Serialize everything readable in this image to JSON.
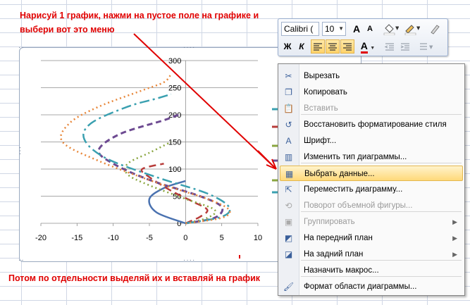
{
  "instructions": {
    "top": "Нарисуй 1 график, нажми на пустое поле на графике и выбери вот это меню",
    "bottom": "Потом по отдельности выделяй их и вставляй на график"
  },
  "toolbar": {
    "font_name": "Calibri (",
    "font_size": "10",
    "grow_font": "A",
    "shrink_font": "A",
    "bold": "Ж",
    "italic": "К",
    "font_color_letter": "A"
  },
  "context_menu": {
    "items": [
      {
        "label": "Вырезать",
        "icon": "scissors-icon",
        "disabled": false
      },
      {
        "label": "Копировать",
        "icon": "copy-icon",
        "disabled": false
      },
      {
        "label": "Вставить",
        "icon": "paste-icon",
        "disabled": true
      },
      {
        "label": "Восстановить форматирование стиля",
        "icon": "reset-style-icon",
        "disabled": false
      },
      {
        "label": "Шрифт...",
        "icon": "font-icon",
        "disabled": false
      },
      {
        "label": "Изменить тип диаграммы...",
        "icon": "chart-type-icon",
        "disabled": false
      },
      {
        "label": "Выбрать данные...",
        "icon": "select-data-icon",
        "disabled": false,
        "highlighted": true
      },
      {
        "label": "Переместить диаграмму...",
        "icon": "move-chart-icon",
        "disabled": false
      },
      {
        "label": "Поворот объемной фигуры...",
        "icon": "rotate-3d-icon",
        "disabled": true
      },
      {
        "label": "Группировать",
        "icon": "group-icon",
        "disabled": true,
        "submenu": true
      },
      {
        "label": "На передний план",
        "icon": "bring-forward-icon",
        "disabled": false,
        "submenu": true
      },
      {
        "label": "На задний план",
        "icon": "send-backward-icon",
        "disabled": false,
        "submenu": true
      },
      {
        "label": "Назначить макрос...",
        "icon": "",
        "disabled": false
      },
      {
        "label": "Формат области диаграммы...",
        "icon": "format-chart-area-icon",
        "disabled": false
      }
    ]
  },
  "colors": {
    "annotation_red": "#e00000",
    "series_blue": "#4a72b0",
    "series_red": "#b83c3a",
    "series_green": "#8aa640",
    "series_purple": "#6d4a91",
    "series_teal": "#3aa0b0",
    "series_orange": "#e8873a"
  },
  "chart_data": {
    "type": "scatter",
    "xticks": [
      "-20",
      "-15",
      "-10",
      "-5",
      "0",
      "5",
      "10"
    ],
    "yticks": [
      "0",
      "50",
      "100",
      "150",
      "200",
      "250",
      "300"
    ],
    "xlim": [
      -20,
      10
    ],
    "ylim": [
      0,
      300
    ],
    "grid": "horizontal",
    "series": [
      {
        "color": "#4a72b0",
        "dash": "solid",
        "width": 2.5,
        "points": [
          [
            0,
            0
          ],
          [
            -4,
            20
          ],
          [
            -5,
            45
          ],
          [
            -3,
            65
          ],
          [
            0,
            78
          ]
        ]
      },
      {
        "color": "#b83c3a",
        "dash": "10,6",
        "width": 2.5,
        "points": [
          [
            0,
            0
          ],
          [
            2,
            12
          ],
          [
            3,
            25
          ],
          [
            1,
            40
          ],
          [
            -2,
            60
          ],
          [
            -5,
            85
          ],
          [
            -6,
            100
          ],
          [
            -3,
            110
          ]
        ]
      },
      {
        "color": "#8aa640",
        "dash": "2,4",
        "width": 2.5,
        "points": [
          [
            0,
            0
          ],
          [
            3,
            10
          ],
          [
            4,
            25
          ],
          [
            0,
            45
          ],
          [
            -5,
            70
          ],
          [
            -8,
            90
          ],
          [
            -8,
            110
          ],
          [
            -5,
            130
          ],
          [
            -2,
            150
          ]
        ]
      },
      {
        "color": "#6d4a91",
        "dash": "8,5",
        "width": 3,
        "points": [
          [
            0,
            0
          ],
          [
            4,
            10
          ],
          [
            5,
            30
          ],
          [
            2,
            50
          ],
          [
            -5,
            80
          ],
          [
            -10,
            110
          ],
          [
            -12,
            135
          ],
          [
            -9,
            165
          ],
          [
            -3,
            190
          ],
          [
            -1,
            200
          ]
        ]
      },
      {
        "color": "#3aa0b0",
        "dash": "14,5,3,5",
        "width": 2.5,
        "points": [
          [
            0,
            0
          ],
          [
            5,
            12
          ],
          [
            6,
            30
          ],
          [
            3,
            55
          ],
          [
            -4,
            85
          ],
          [
            -11,
            120
          ],
          [
            -14,
            155
          ],
          [
            -13,
            185
          ],
          [
            -8,
            215
          ],
          [
            -4,
            230
          ],
          [
            -2,
            238
          ]
        ]
      },
      {
        "color": "#e8873a",
        "dash": "2,4",
        "width": 2.5,
        "points": [
          [
            0,
            0
          ],
          [
            5,
            10
          ],
          [
            6,
            25
          ],
          [
            3,
            45
          ],
          [
            -4,
            75
          ],
          [
            -12,
            115
          ],
          [
            -17,
            150
          ],
          [
            -16,
            185
          ],
          [
            -12,
            215
          ],
          [
            -6,
            245
          ],
          [
            -3,
            260
          ],
          [
            -2,
            275
          ]
        ]
      }
    ],
    "legend_markers": [
      {
        "color": "#3aa0b0"
      },
      {
        "color": "#b83c3a"
      },
      {
        "color": "#8aa640"
      },
      {
        "color": "#6d4a91"
      },
      {
        "color": "#8aa640"
      },
      {
        "color": "#3aa0b0"
      }
    ]
  }
}
